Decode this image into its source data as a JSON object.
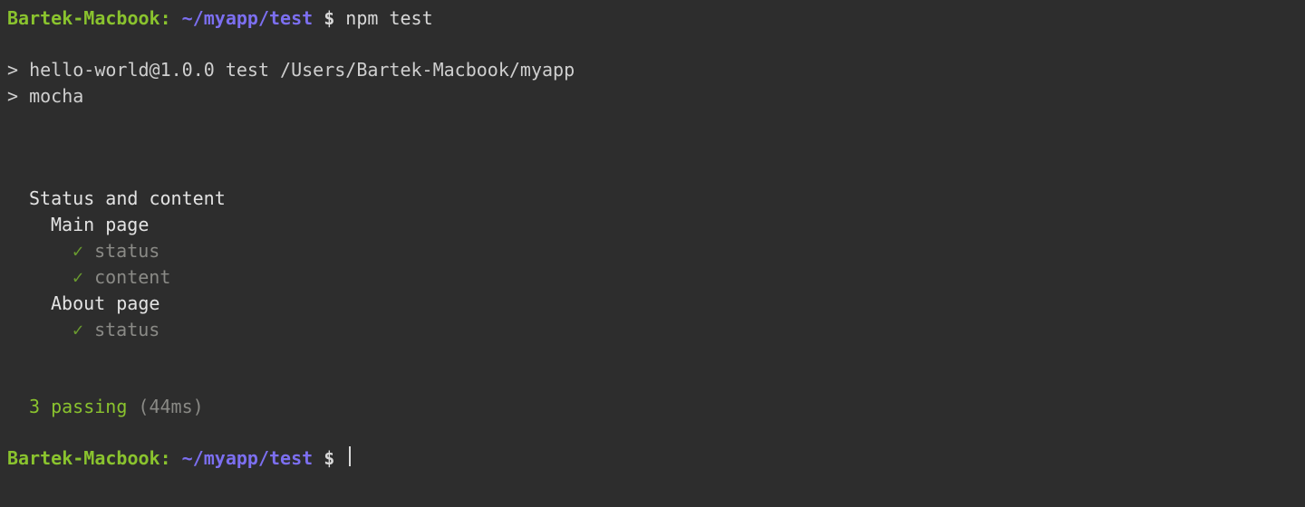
{
  "prompt1": {
    "host": "Bartek-Macbook:",
    "path": " ~/myapp/test ",
    "dollar": "$ ",
    "command": "npm test"
  },
  "output": {
    "line1": "> hello-world@1.0.0 test /Users/Bartek-Macbook/myapp",
    "line2": "> mocha"
  },
  "test": {
    "suite": "Status and content",
    "group1": "Main page",
    "check": "✓",
    "case1": " status",
    "case2": " content",
    "group2": "About page",
    "case3": " status"
  },
  "summary": {
    "passing": "3 passing ",
    "time": "(44ms)"
  },
  "prompt2": {
    "host": "Bartek-Macbook:",
    "path": " ~/myapp/test ",
    "dollar": "$ "
  }
}
